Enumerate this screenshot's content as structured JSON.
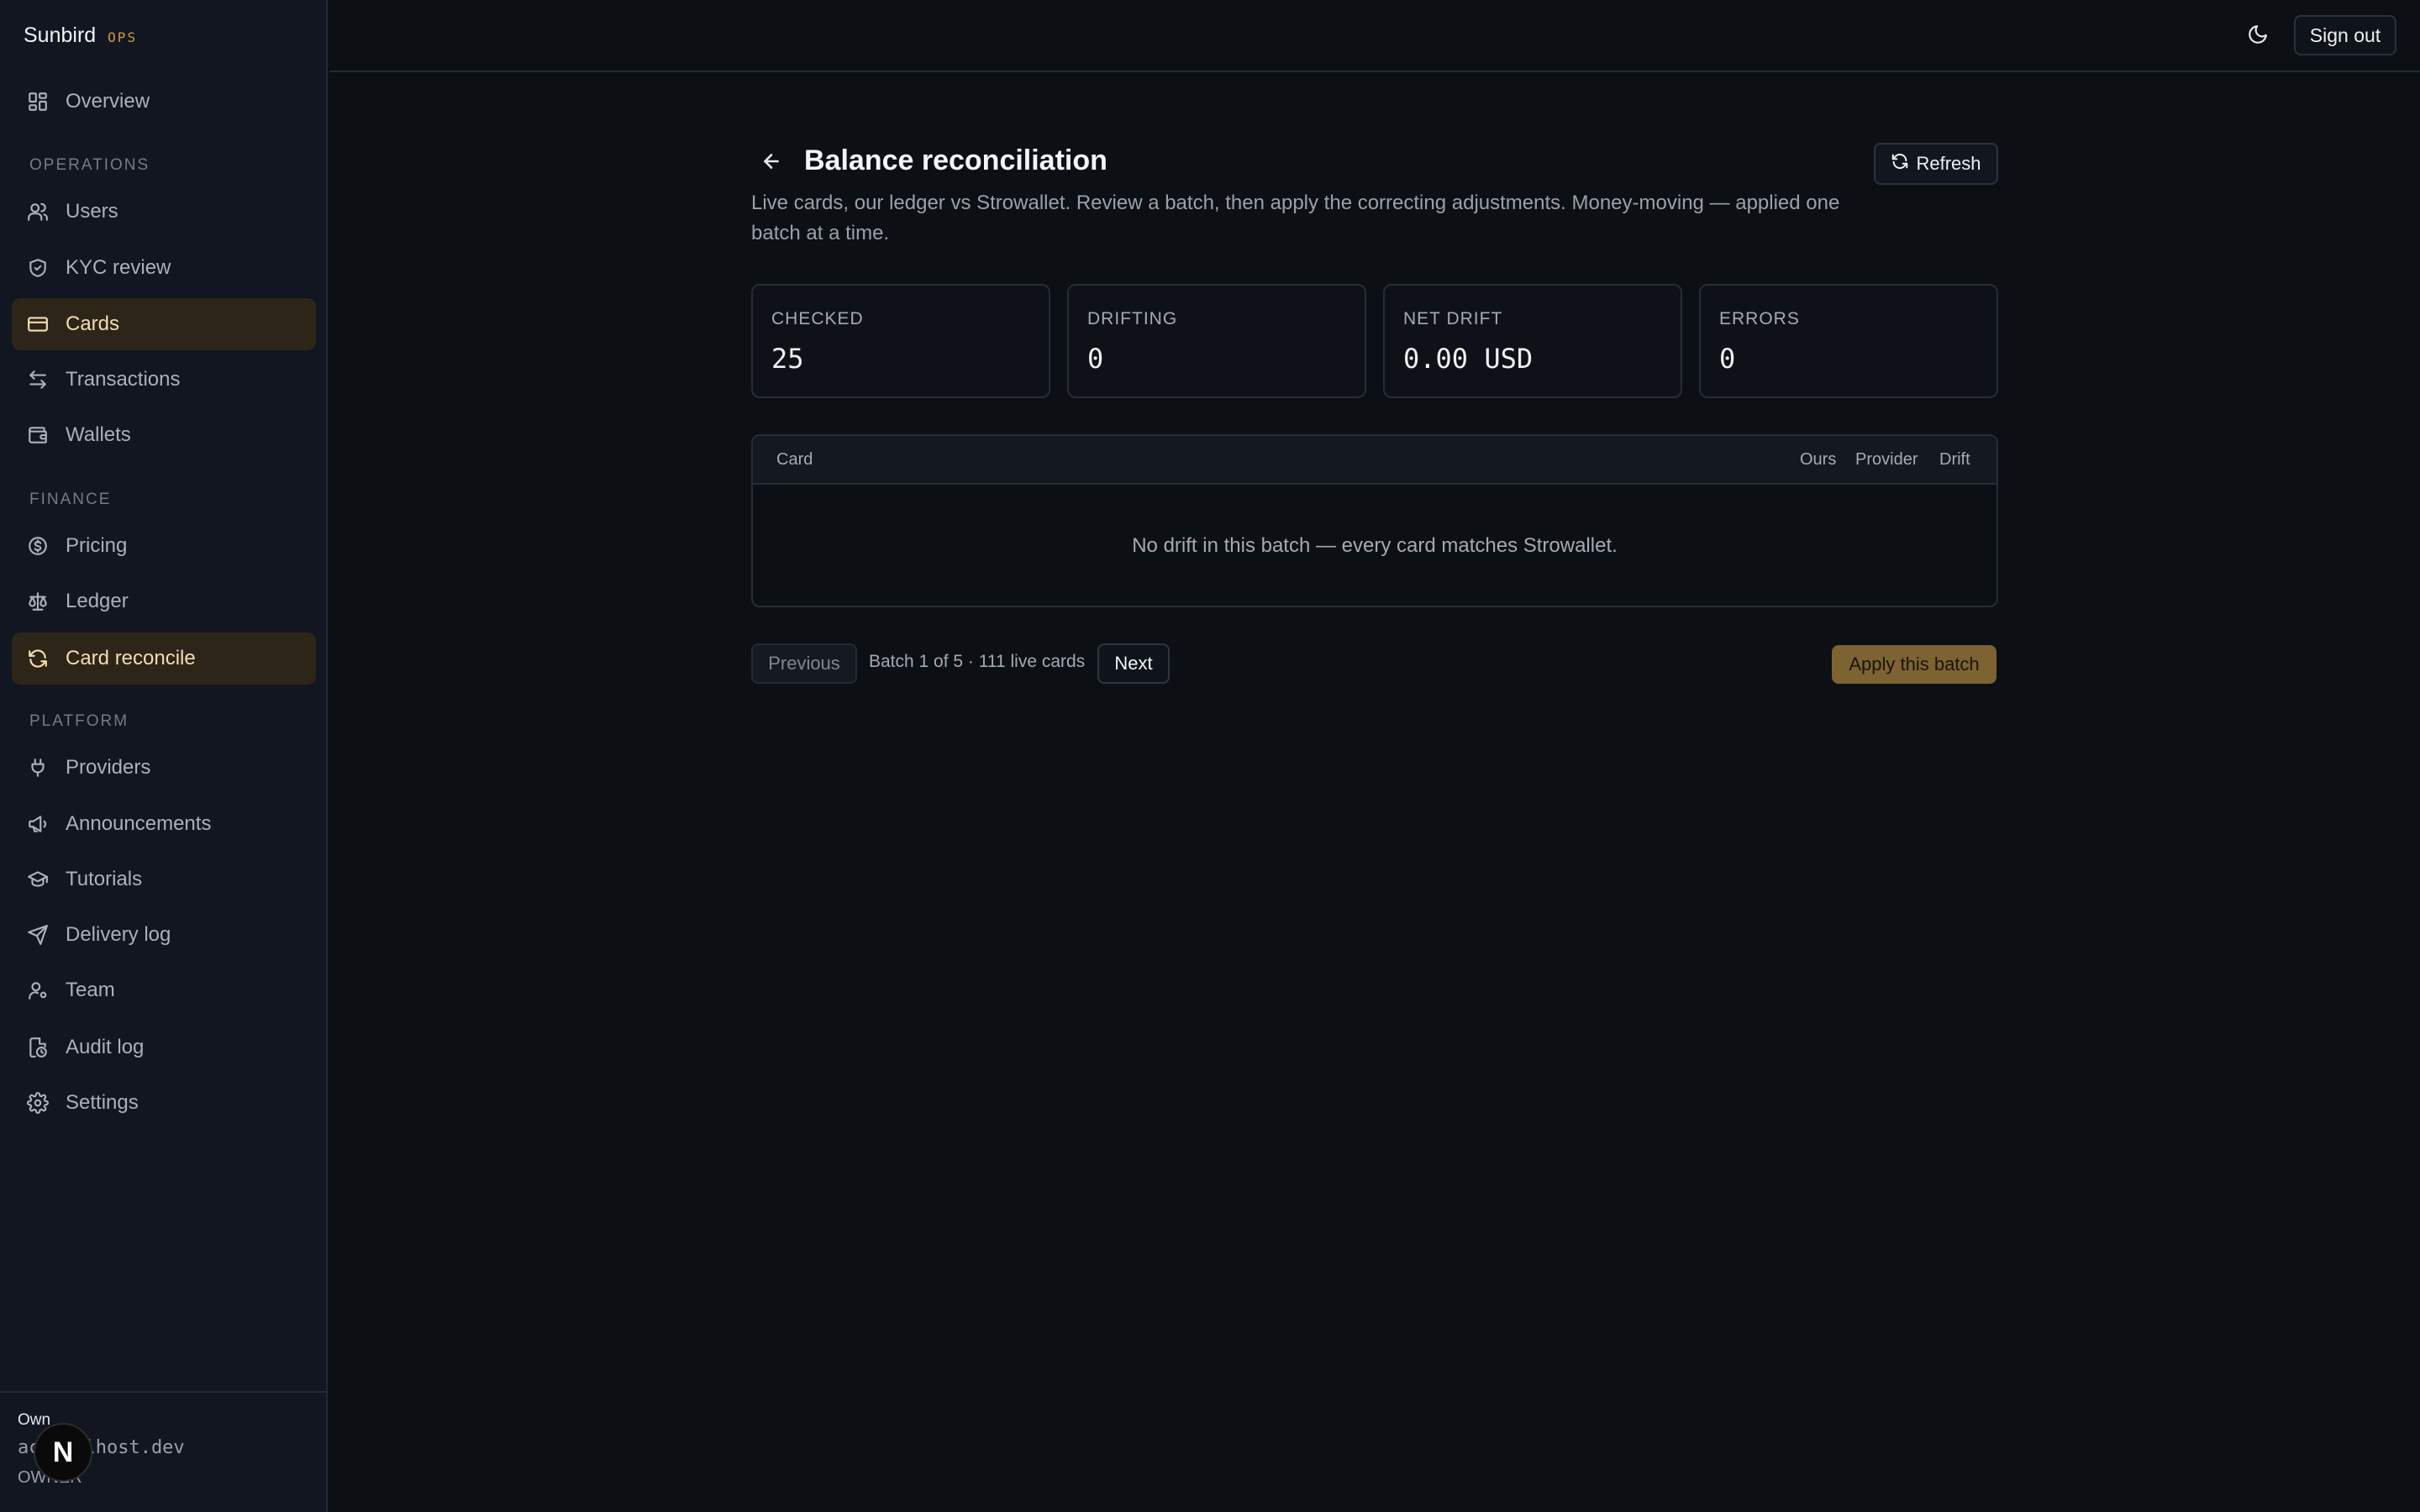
{
  "brand": {
    "name": "Sunbird",
    "tag": "OPS"
  },
  "nav": {
    "overview": "Overview",
    "sections": {
      "operations": "OPERATIONS",
      "finance": "FINANCE",
      "platform": "PLATFORM"
    },
    "items": {
      "users": "Users",
      "kyc": "KYC review",
      "cards": "Cards",
      "transactions": "Transactions",
      "wallets": "Wallets",
      "pricing": "Pricing",
      "ledger": "Ledger",
      "card_reconcile": "Card reconcile",
      "providers": "Providers",
      "announcements": "Announcements",
      "tutorials": "Tutorials",
      "delivery_log": "Delivery log",
      "team": "Team",
      "audit_log": "Audit log",
      "settings": "Settings"
    },
    "active": [
      "Cards",
      "Card reconcile"
    ]
  },
  "account": {
    "label": "Own",
    "email": "ac     ocalhost.dev",
    "role": "OWNER"
  },
  "next_badge": "N",
  "topbar": {
    "signout": "Sign out",
    "theme_icon": "moon-icon"
  },
  "page": {
    "title": "Balance reconciliation",
    "refresh": "Refresh",
    "description": "Live cards, our ledger vs Strowallet. Review a batch, then apply the correcting adjustments. Money-moving — applied one batch at a time."
  },
  "stats": [
    {
      "label": "CHECKED",
      "value": "25"
    },
    {
      "label": "DRIFTING",
      "value": "0"
    },
    {
      "label": "NET DRIFT",
      "value": "0.00 USD"
    },
    {
      "label": "ERRORS",
      "value": "0"
    }
  ],
  "table": {
    "headers": {
      "card": "Card",
      "ours": "Ours",
      "provider": "Provider",
      "drift": "Drift"
    },
    "empty": "No drift in this batch — every card matches Strowallet."
  },
  "pager": {
    "previous": "Previous",
    "info": "Batch 1 of 5 · 111 live cards",
    "next": "Next",
    "apply": "Apply this batch"
  },
  "colors": {
    "background": "#0c0f14",
    "sidebar": "#111621",
    "accent": "#d29a3f",
    "active_bg": "#2e2519",
    "apply_bg": "#7d6232"
  }
}
